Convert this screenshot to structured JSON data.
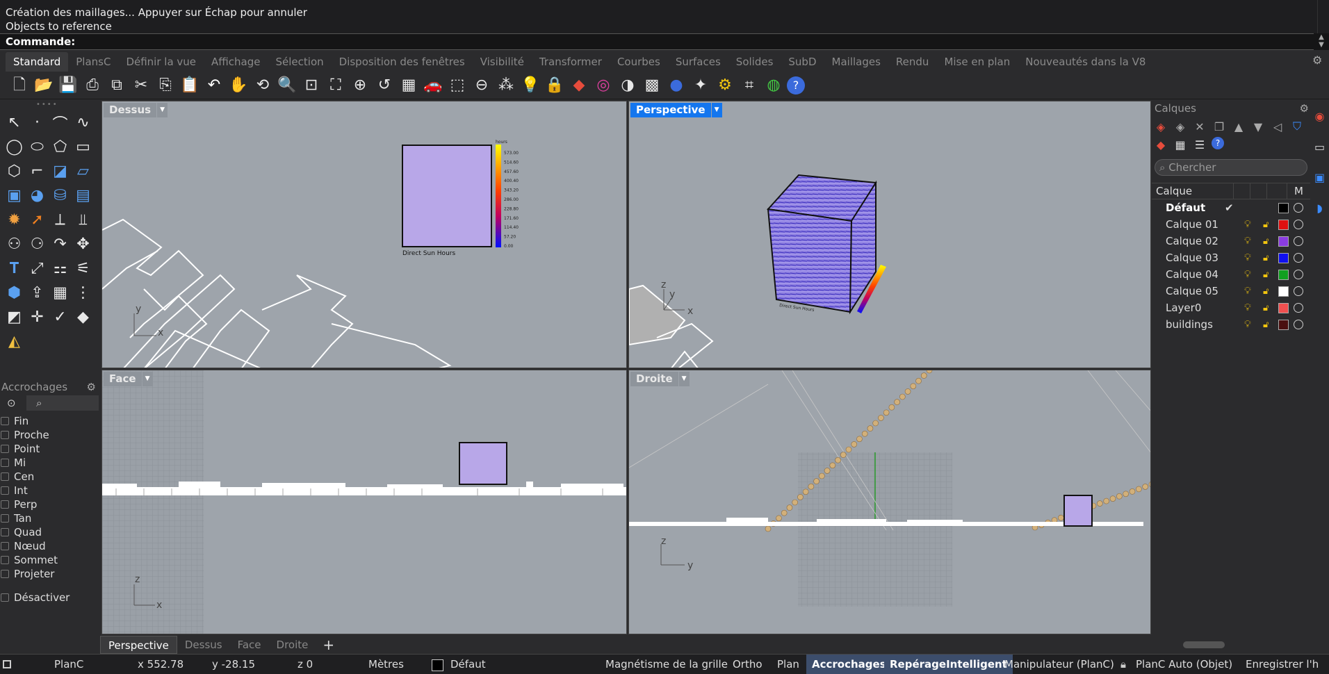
{
  "history": {
    "lines": [
      "Création des maillages... Appuyer sur Échap pour annuler",
      "Objects to reference"
    ]
  },
  "command": {
    "label": "Commande:"
  },
  "tabs": [
    "Standard",
    "PlansC",
    "Définir la vue",
    "Affichage",
    "Sélection",
    "Disposition des fenêtres",
    "Visibilité",
    "Transformer",
    "Courbes",
    "Surfaces",
    "Solides",
    "SubD",
    "Maillages",
    "Rendu",
    "Mise en plan",
    "Nouveautés dans la V8"
  ],
  "toolbar_icons": [
    "new-icon",
    "open-icon",
    "save-icon",
    "print-icon",
    "copy-props-icon",
    "cut-icon",
    "copy-icon",
    "paste-icon",
    "undo-icon",
    "pan-icon",
    "rotate-view-icon",
    "zoom-icon",
    "zoom-window-icon",
    "zoom-extents-icon",
    "zoom-selected-icon",
    "undo-view-icon",
    "viewport-layout-icon",
    "car-icon",
    "named-cplane-icon",
    "cplane-icon",
    "snap-icon",
    "light-icon",
    "lock-icon",
    "layer-icon",
    "color-wheel-icon",
    "shade-icon",
    "wireframe-icon",
    "render-icon",
    "rendered-icon",
    "settings-icon",
    "grid-snap-icon",
    "sphere-icon",
    "help-icon"
  ],
  "left_tools": [
    "select-arrow-icon",
    "point-icon",
    "polyline-icon",
    "curve-icon",
    "circle-icon",
    "ellipse-icon",
    "polygon-icon",
    "rectangle-icon",
    "hexagon-icon",
    "fillet-icon",
    "surface-icon",
    "plane-icon",
    "box-icon",
    "sphere-tool-icon",
    "cylinder-icon",
    "mesh-icon",
    "transform-gizmo-icon",
    "arrow-tool-icon",
    "split-icon",
    "trim-icon",
    "group-icon",
    "boolean-icon",
    "rotate-icon",
    "move-icon",
    "text-icon",
    "scale-icon",
    "array-icon",
    "mirror-icon",
    "solid-box-icon",
    "extrude-icon",
    "grid-array-icon",
    "dimension-icon",
    "cut-plane-icon",
    "gumball-icon",
    "check-icon",
    "shaded-solid-icon",
    "pyramid-icon"
  ],
  "osnaps": {
    "title": "Accrochages",
    "items": [
      "Fin",
      "Proche",
      "Point",
      "Mi",
      "Cen",
      "Int",
      "Perp",
      "Tan",
      "Quad",
      "Nœud",
      "Sommet",
      "Projeter"
    ],
    "disable": "Désactiver"
  },
  "viewports": {
    "top": {
      "name": "Dessus",
      "axis_a": "y",
      "axis_b": "x",
      "legend_title": "hours",
      "legend_values": [
        "573.00",
        "514.60",
        "457.60",
        "400.40",
        "343.20",
        "286.00",
        "228.80",
        "171.60",
        "114.40",
        "57.20",
        "0.00"
      ],
      "caption": "Direct Sun Hours"
    },
    "perspective": {
      "name": "Perspective",
      "axis_a": "z",
      "axis_b": "y",
      "axis_c": "x",
      "caption": "Direct Sun Hours"
    },
    "front": {
      "name": "Face",
      "axis_a": "z",
      "axis_b": "x"
    },
    "right": {
      "name": "Droite",
      "axis_a": "z",
      "axis_b": "y"
    }
  },
  "view_tabs": [
    "Perspective",
    "Dessus",
    "Face",
    "Droite"
  ],
  "add_tab": "+",
  "panel": {
    "title": "Calques",
    "search_placeholder": "Chercher",
    "col_layer": "Calque",
    "col_m": "M",
    "layers": [
      {
        "name": "Défaut",
        "color": "#000000"
      },
      {
        "name": "Calque 01",
        "color": "#e01010"
      },
      {
        "name": "Calque 02",
        "color": "#8a3ce0"
      },
      {
        "name": "Calque 03",
        "color": "#1010f0"
      },
      {
        "name": "Calque 04",
        "color": "#10a020"
      },
      {
        "name": "Calque 05",
        "color": "#ffffff"
      },
      {
        "name": "Layer0",
        "color": "#f05050"
      },
      {
        "name": "buildings",
        "color": "#4a1010"
      }
    ]
  },
  "status": {
    "cplane": "PlanC",
    "x": "x 552.78",
    "y": "y -28.15",
    "z": "z 0",
    "units": "Mètres",
    "layer": "Défaut",
    "grid_snap": "Magnétisme de la grille",
    "ortho": "Ortho",
    "plan": "Plan",
    "osnap": "Accrochages",
    "smarttrack": "RepérageIntelligent",
    "gumball": "Manipulateur (PlanC)",
    "autocplane": "PlanC Auto (Objet)",
    "record": "Enregistrer l'h"
  }
}
